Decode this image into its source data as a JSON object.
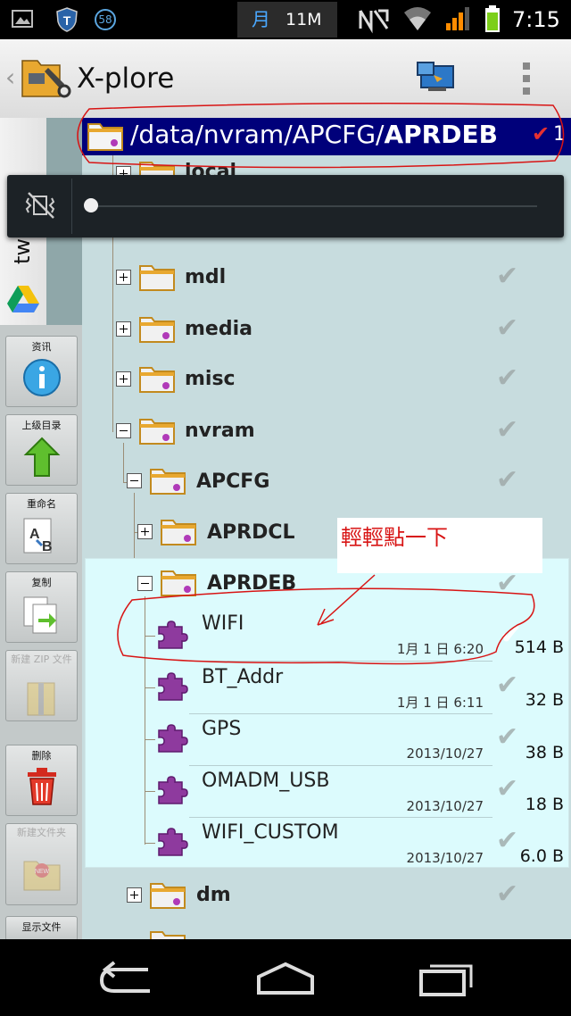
{
  "status_bar": {
    "notif_count": "58",
    "carrier": "月",
    "speed": "11M",
    "time": "7:15"
  },
  "action_bar": {
    "title": "X-plore"
  },
  "path_bar": {
    "path_prefix": "/data/nvram/APCFG/",
    "path_current": "APRDEB",
    "selected_count": "1"
  },
  "side_tab": {
    "label": "twa ar..."
  },
  "toolbar": [
    {
      "label": "资讯",
      "icon": "info-icon",
      "enabled": true
    },
    {
      "label": "上级目录",
      "icon": "up-arrow-icon",
      "enabled": true
    },
    {
      "label": "重命名",
      "icon": "rename-icon",
      "enabled": true
    },
    {
      "label": "复制",
      "icon": "copy-icon",
      "enabled": true
    },
    {
      "label": "新建 ZIP 文件",
      "icon": "zip-icon",
      "enabled": false
    },
    {
      "label": "删除",
      "icon": "trash-icon",
      "enabled": true
    },
    {
      "label": "新建文件夹",
      "icon": "new-folder-icon",
      "enabled": false
    },
    {
      "label": "显示文件",
      "icon": "show-files-icon",
      "enabled": true
    }
  ],
  "tree": {
    "partial_top": "local",
    "folders": [
      {
        "name": "mdl"
      },
      {
        "name": "media"
      },
      {
        "name": "misc"
      },
      {
        "name": "nvram"
      },
      {
        "name": "APCFG"
      },
      {
        "name": "APRDCL"
      },
      {
        "name": "APRDEB"
      }
    ],
    "files": [
      {
        "name": "WIFI",
        "date": "1月 1 日 6:20",
        "size": "514 B"
      },
      {
        "name": "BT_Addr",
        "date": "1月 1 日 6:11",
        "size": "32 B"
      },
      {
        "name": "GPS",
        "date": "2013/10/27",
        "size": "38 B"
      },
      {
        "name": "OMADM_USB",
        "date": "2013/10/27",
        "size": "18 B"
      },
      {
        "name": "WIFI_CUSTOM",
        "date": "2013/10/27",
        "size": "6.0 B"
      }
    ],
    "after": [
      {
        "name": "dm"
      }
    ]
  },
  "annotation": {
    "text": "輕輕點一下"
  },
  "colors": {
    "path_bar": "#00007a",
    "selected_panel": "#dcfbfd",
    "annotation": "#d81414",
    "tree_bg": "#c7dcde"
  }
}
